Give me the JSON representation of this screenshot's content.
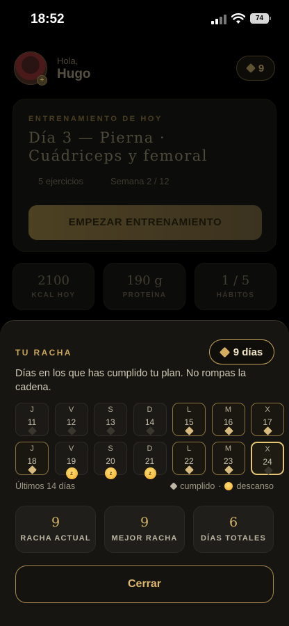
{
  "status_bar": {
    "time": "18:52",
    "battery": "74"
  },
  "user": {
    "greeting": "Hola,",
    "name": "Hugo",
    "gems": "9"
  },
  "today": {
    "kicker": "ENTRENAMIENTO DE HOY",
    "title": "Día 3 — Pierna · Cuádriceps y femoral",
    "exercises": "5 ejercicios",
    "week": "Semana 2 / 12",
    "start_label": "EMPEZAR ENTRENAMIENTO"
  },
  "daily_stats": [
    {
      "value": "2100",
      "label": "KCAL HOY"
    },
    {
      "value": "190 g",
      "label": "PROTEÍNA"
    },
    {
      "value": "1 / 5",
      "label": "HÁBITOS"
    }
  ],
  "streak_sheet": {
    "title": "TU RACHA",
    "pill": "9 días",
    "description": "Días en los que has cumplido tu plan. No rompas la cadena.",
    "legend_left": "Últimos 14 días",
    "legend_done": "cumplido",
    "legend_sep": "·",
    "legend_rest": "descanso",
    "days": [
      {
        "wd": "J",
        "num": "11",
        "state": "missed"
      },
      {
        "wd": "V",
        "num": "12",
        "state": "missed"
      },
      {
        "wd": "S",
        "num": "13",
        "state": "missed"
      },
      {
        "wd": "D",
        "num": "14",
        "state": "missed"
      },
      {
        "wd": "L",
        "num": "15",
        "state": "done"
      },
      {
        "wd": "M",
        "num": "16",
        "state": "done"
      },
      {
        "wd": "X",
        "num": "17",
        "state": "done"
      },
      {
        "wd": "J",
        "num": "18",
        "state": "done"
      },
      {
        "wd": "V",
        "num": "19",
        "state": "rest"
      },
      {
        "wd": "S",
        "num": "20",
        "state": "rest"
      },
      {
        "wd": "D",
        "num": "21",
        "state": "rest"
      },
      {
        "wd": "L",
        "num": "22",
        "state": "done"
      },
      {
        "wd": "M",
        "num": "23",
        "state": "done"
      },
      {
        "wd": "X",
        "num": "24",
        "state": "today"
      }
    ],
    "stats": [
      {
        "value": "9",
        "label": "RACHA ACTUAL"
      },
      {
        "value": "9",
        "label": "MEJOR RACHA"
      },
      {
        "value": "6",
        "label": "DÍAS TOTALES"
      }
    ],
    "close_label": "Cerrar"
  }
}
